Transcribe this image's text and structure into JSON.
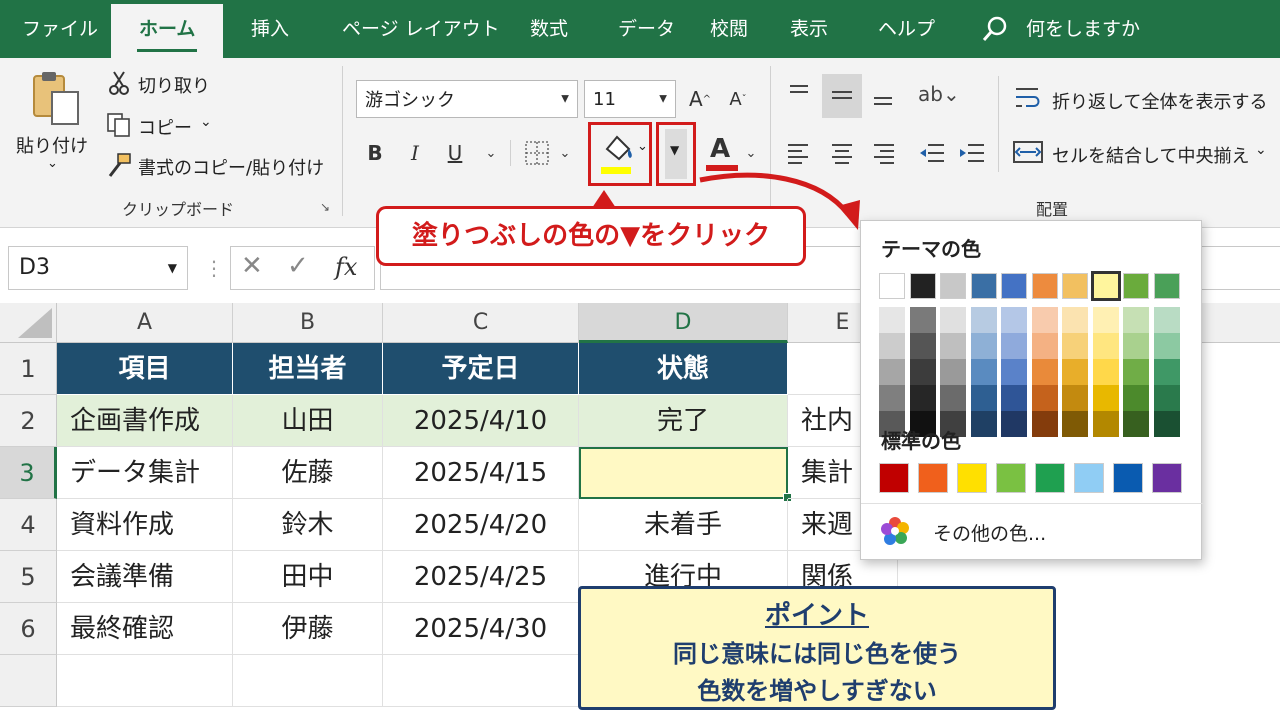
{
  "tabs": [
    {
      "label": "ファイル"
    },
    {
      "label": "ホーム"
    },
    {
      "label": "挿入"
    },
    {
      "label": "ページ レイアウト"
    },
    {
      "label": "数式"
    },
    {
      "label": "データ"
    },
    {
      "label": "校閲"
    },
    {
      "label": "表示"
    },
    {
      "label": "ヘルプ"
    }
  ],
  "search": {
    "label": "何をしますか"
  },
  "clipboard": {
    "paste": "貼り付け",
    "cut": "切り取り",
    "copy": "コピー",
    "format_painter": "書式のコピー/貼り付け",
    "group_label": "クリップボード"
  },
  "font": {
    "name": "游ゴシック",
    "size": "11",
    "bold": "B",
    "italic": "I",
    "underline": "U",
    "font_color": "A",
    "grow": "A",
    "shrink": "A"
  },
  "alignment": {
    "wrap": "折り返して全体を表示する",
    "merge": "セルを結合して中央揃え",
    "group_label": "配置"
  },
  "formula_bar": {
    "name_box": "D3",
    "fx": "fx"
  },
  "columns": [
    "A",
    "B",
    "C",
    "D",
    "E"
  ],
  "rows": [
    "1",
    "2",
    "3",
    "4",
    "5",
    "6"
  ],
  "table": {
    "headers": [
      "項目",
      "担当者",
      "予定日",
      "状態"
    ],
    "rows": [
      [
        "企画書作成",
        "山田",
        "2025/4/10",
        "完了",
        "社内"
      ],
      [
        "データ集計",
        "佐藤",
        "2025/4/15",
        "",
        "集計"
      ],
      [
        "資料作成",
        "鈴木",
        "2025/4/20",
        "未着手",
        "来週"
      ],
      [
        "会議準備",
        "田中",
        "2025/4/25",
        "進行中",
        "関係"
      ],
      [
        "最終確認",
        "伊藤",
        "2025/4/30",
        "",
        ""
      ]
    ]
  },
  "callout": {
    "text": "塗りつぶしの色の▼をクリック"
  },
  "point": {
    "title": "ポイント",
    "line1": "同じ意味には同じ色を使う",
    "line2": "色数を増やしすぎない"
  },
  "color_panel": {
    "theme_title": "テーマの色",
    "standard_title": "標準の色",
    "more_colors": "その他の色...",
    "theme_top": [
      "#ffffff",
      "#222222",
      "#c8c8c8",
      "#3a6fa5",
      "#4472c4",
      "#ed8b3e",
      "#f2c060",
      "#fff59d",
      "#6aab3c",
      "#4aa058"
    ],
    "theme_shades": [
      [
        "#e6e6e6",
        "#7a7a7a",
        "#e0e0e0",
        "#b7cbe2",
        "#b4c7e7",
        "#f8cbad",
        "#fbe3b0",
        "#fff0b3",
        "#c6e0b4",
        "#b9dcc4"
      ],
      [
        "#cccccc",
        "#555555",
        "#bfbfbf",
        "#8eb0d6",
        "#8faadc",
        "#f4b183",
        "#f7d179",
        "#ffe680",
        "#a9d18e",
        "#8cc9a2"
      ],
      [
        "#a6a6a6",
        "#3c3c3c",
        "#9a9a9a",
        "#5a8bc0",
        "#5a82c9",
        "#e98a3a",
        "#e8ae2a",
        "#ffd84a",
        "#70ad47",
        "#3f9866"
      ],
      [
        "#7f7f7f",
        "#262626",
        "#6b6b6b",
        "#2e5f92",
        "#2f5597",
        "#c5621c",
        "#c38a0f",
        "#e8b800",
        "#4c8a2c",
        "#2a7a4c"
      ],
      [
        "#595959",
        "#111111",
        "#404040",
        "#1f4064",
        "#203864",
        "#843c0c",
        "#7f5a05",
        "#b38800",
        "#37601f",
        "#1a5032"
      ]
    ],
    "standard": [
      "#c00000",
      "#f0601c",
      "#ffe000",
      "#7ac142",
      "#1fa050",
      "#90cdf4",
      "#0a5bb0",
      "#6a2fa0"
    ]
  }
}
